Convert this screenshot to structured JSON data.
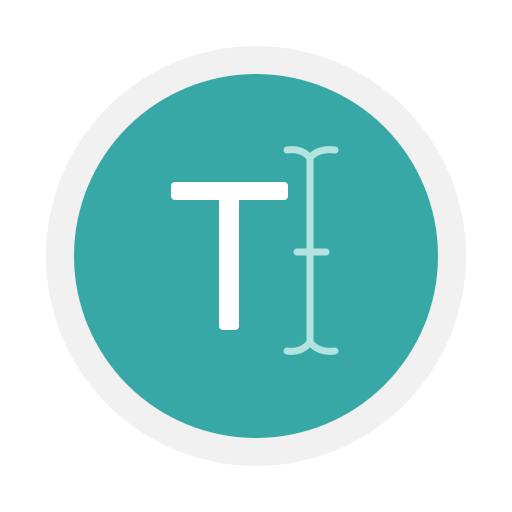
{
  "icon": {
    "name": "text-cursor-app-icon",
    "letter_icon": "letter-t-icon",
    "cursor_icon": "text-insertion-cursor-icon"
  },
  "colors": {
    "outer_ring": "#f1f1f1",
    "circle_fill": "#37a8a6",
    "letter": "#ffffff",
    "cursor": "#b2e3de"
  }
}
